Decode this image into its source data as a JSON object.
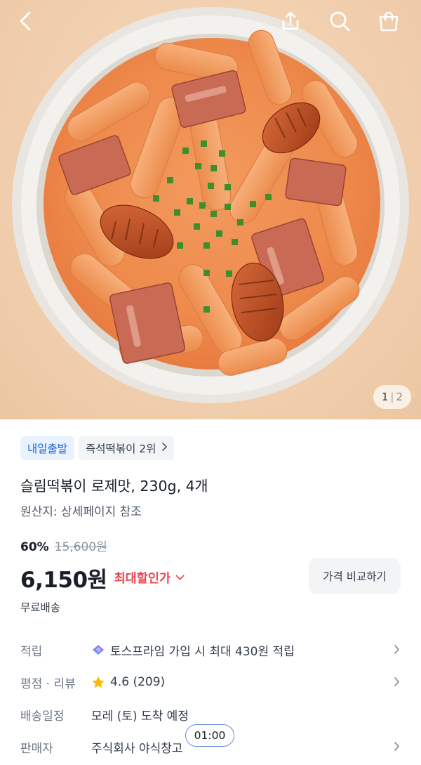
{
  "gallery": {
    "current": "1",
    "separator": "|",
    "total": "2"
  },
  "header": {
    "icons": [
      "back-icon",
      "share-icon",
      "search-icon",
      "shopping-bag-icon"
    ]
  },
  "badges": {
    "delivery": "내일출발",
    "ranking": "즉석떡볶이 2위"
  },
  "product": {
    "title": "슬림떡볶이 로제맛, 230g, 4개",
    "origin": "원산지: 상세페이지 참조",
    "discount_rate": "60%",
    "original_price": "15,600원",
    "price": "6,150원",
    "max_discount_label": "최대할인가",
    "compare_button": "가격 비교하기",
    "shipping": "무료배송"
  },
  "details": [
    {
      "label": "적립",
      "value": "토스프라임 가입 시 최대 430원 적립",
      "icon": "prime-icon"
    },
    {
      "label": "평점 · 리뷰",
      "value": "4.6 (209)",
      "icon": "star-icon"
    },
    {
      "label": "배송일정",
      "value": "모레 (토) 도착 예정"
    },
    {
      "label": "판매자",
      "value": "주식회사 야식창고"
    }
  ],
  "timer": "01:00",
  "colors": {
    "accent_blue": "#1b64da",
    "sale_red": "#f04452",
    "star_yellow": "#ffb800"
  }
}
